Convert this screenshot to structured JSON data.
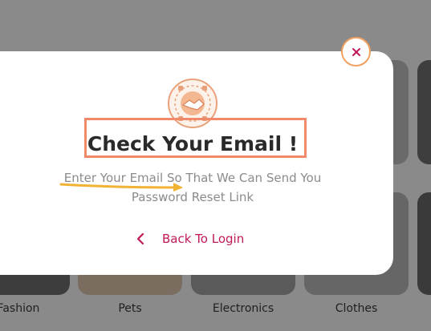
{
  "modal": {
    "title": "Check Your Email !",
    "description_line1": "Enter Your Email So That We Can Send You",
    "description_line2": "Password Reset Link",
    "back_label": "Back To Login"
  },
  "categories": [
    {
      "label": "Fashion"
    },
    {
      "label": "Pets"
    },
    {
      "label": "Electronics"
    },
    {
      "label": "Clothes"
    }
  ],
  "colors": {
    "accent": "#c0185a",
    "highlight_box": "#f08a6a",
    "arrow": "#f2b233",
    "close_ring": "#f0a060"
  },
  "icons": {
    "close": "close-icon",
    "back": "chevron-left-icon",
    "logo": "handshake-logo"
  }
}
